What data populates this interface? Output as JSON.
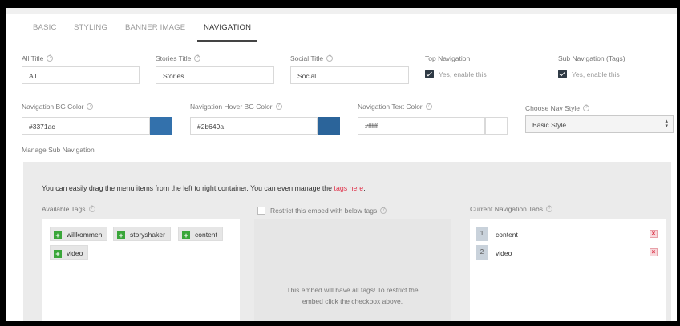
{
  "tabs": [
    {
      "label": "BASIC"
    },
    {
      "label": "STYLING"
    },
    {
      "label": "BANNER IMAGE"
    },
    {
      "label": "NAVIGATION"
    }
  ],
  "fields": {
    "all_title": {
      "label": "All Title",
      "value": "All"
    },
    "stories_title": {
      "label": "Stories Title",
      "value": "Stories"
    },
    "social_title": {
      "label": "Social Title",
      "value": "Social"
    },
    "top_navigation": {
      "label": "Top Navigation",
      "checkbox_label": "Yes, enable this",
      "checked": true
    },
    "sub_navigation": {
      "label": "Sub Navigation (Tags)",
      "checkbox_label": "Yes, enable this",
      "checked": true
    },
    "nav_bg_color": {
      "label": "Navigation BG Color",
      "value": "#3371ac",
      "swatch": "#3371ac"
    },
    "nav_hover_bg_color": {
      "label": "Navigation Hover BG Color",
      "value": "#2b649a",
      "swatch": "#2b649a"
    },
    "nav_text_color": {
      "label": "Navigation Text Color",
      "value": "#ffffff",
      "swatch": "#ffffff"
    },
    "nav_style": {
      "label": "Choose Nav Style",
      "value": "Basic Style"
    }
  },
  "manage": {
    "heading": "Manage Sub Navigation",
    "info_prefix": "You can easily drag the menu items from the left to right container. You can even manage the ",
    "info_link": "tags here",
    "info_suffix": ".",
    "available_tags_label": "Available Tags",
    "available_tags": [
      "willkommen",
      "storyshaker",
      "content",
      "video"
    ],
    "restrict_label": "Restrict this embed with below tags",
    "restrict_message_line1": "This embed will have all tags! To restrict the",
    "restrict_message_line2": "embed click the checkbox above.",
    "current_tabs_label": "Current Navigation Tabs",
    "current_tabs": [
      {
        "num": "1",
        "label": "content"
      },
      {
        "num": "2",
        "label": "video"
      }
    ]
  },
  "colors": {
    "accent_link": "#e0334b",
    "add_green": "#3aa63a",
    "remove_red": "#d9293f"
  }
}
